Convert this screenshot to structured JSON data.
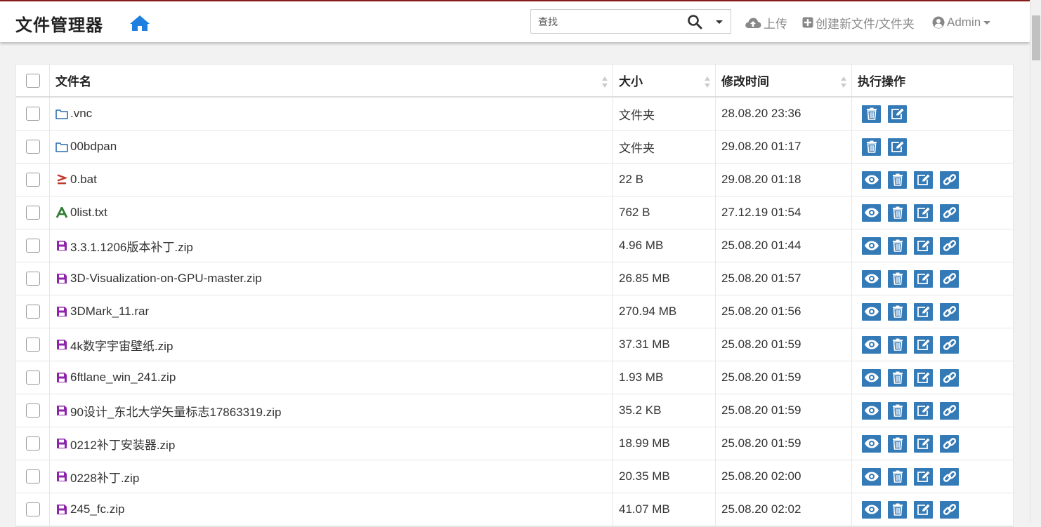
{
  "app": {
    "title": "文件管理器"
  },
  "search": {
    "placeholder": "查找"
  },
  "nav": {
    "upload": "上传",
    "create": "创建新文件/文件夹",
    "user": "Admin"
  },
  "table": {
    "headers": {
      "name": "文件名",
      "size": "大小",
      "modified": "修改时间",
      "actions": "执行操作"
    },
    "rows": [
      {
        "name": ".vnc",
        "size": "文件夹",
        "modified": "28.08.20 23:36",
        "type": "folder"
      },
      {
        "name": "00bdpan",
        "size": "文件夹",
        "modified": "29.08.20 01:17",
        "type": "folder"
      },
      {
        "name": "0.bat",
        "size": "22 B",
        "modified": "29.08.20 01:18",
        "type": "script"
      },
      {
        "name": "0list.txt",
        "size": "762 B",
        "modified": "27.12.19 01:54",
        "type": "text"
      },
      {
        "name": "3.3.1.1206版本补丁.zip",
        "size": "4.96 MB",
        "modified": "25.08.20 01:44",
        "type": "archive"
      },
      {
        "name": "3D-Visualization-on-GPU-master.zip",
        "size": "26.85 MB",
        "modified": "25.08.20 01:57",
        "type": "archive"
      },
      {
        "name": "3DMark_11.rar",
        "size": "270.94 MB",
        "modified": "25.08.20 01:56",
        "type": "archive"
      },
      {
        "name": "4k数字宇宙壁纸.zip",
        "size": "37.31 MB",
        "modified": "25.08.20 01:59",
        "type": "archive"
      },
      {
        "name": "6ftlane_win_241.zip",
        "size": "1.93 MB",
        "modified": "25.08.20 01:59",
        "type": "archive"
      },
      {
        "name": "90设计_东北大学矢量标志17863319.zip",
        "size": "35.2 KB",
        "modified": "25.08.20 01:59",
        "type": "archive"
      },
      {
        "name": "0212补丁安装器.zip",
        "size": "18.99 MB",
        "modified": "25.08.20 01:59",
        "type": "archive"
      },
      {
        "name": "0228补丁.zip",
        "size": "20.35 MB",
        "modified": "25.08.20 02:00",
        "type": "archive"
      },
      {
        "name": "245_fc.zip",
        "size": "41.07 MB",
        "modified": "25.08.20 02:02",
        "type": "archive"
      }
    ]
  },
  "colors": {
    "accent": "#337ab7",
    "home": "#1e7fe0",
    "folder": "#2a6fb0",
    "script": "#c0392b",
    "text": "#2e7d32",
    "archive": "#8e24aa"
  },
  "icons": {
    "folder": "folder-icon",
    "script": "terminal-icon",
    "text": "text-file-icon",
    "archive": "archive-icon"
  }
}
